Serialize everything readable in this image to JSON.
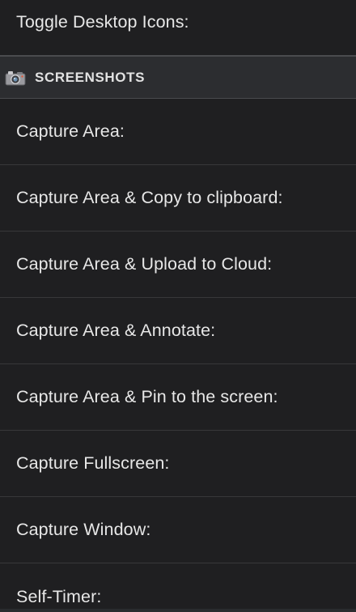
{
  "rows_top": [
    {
      "label": "Toggle Desktop Icons:"
    }
  ],
  "section": {
    "title": "SCREENSHOTS",
    "icon": "camera-icon"
  },
  "rows": [
    {
      "label": "Capture Area:"
    },
    {
      "label": "Capture Area & Copy to clipboard:"
    },
    {
      "label": "Capture Area & Upload to Cloud:"
    },
    {
      "label": "Capture Area & Annotate:"
    },
    {
      "label": "Capture Area & Pin to the screen:"
    },
    {
      "label": "Capture Fullscreen:"
    },
    {
      "label": "Capture Window:"
    },
    {
      "label": "Self-Timer:"
    }
  ],
  "colors": {
    "background": "#1f1f21",
    "section_background": "#2c2d30",
    "divider": "#38383a",
    "text": "#e7e7e7"
  }
}
